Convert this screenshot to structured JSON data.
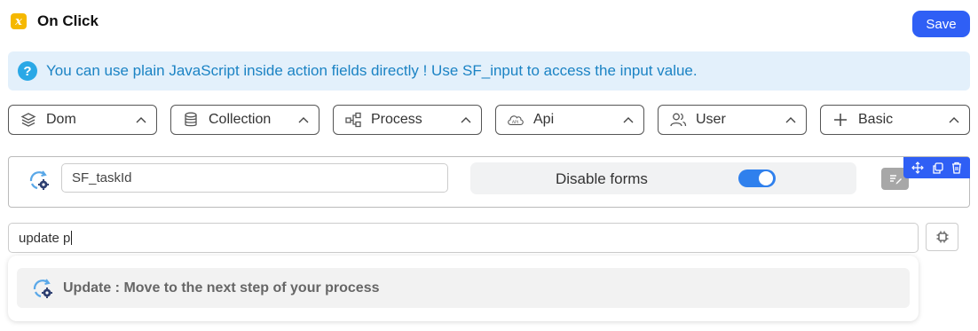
{
  "header": {
    "title": "On Click",
    "save_label": "Save",
    "icon": "function-x-icon",
    "accent": "#f5b800"
  },
  "info": {
    "text": "You can use plain JavaScript inside action fields directly ! Use SF_input to access the input value.",
    "icon": "question-icon",
    "color": "#1b83c4",
    "background": "#e3f0fb"
  },
  "categories": [
    {
      "label": "Dom",
      "icon": "layers-icon"
    },
    {
      "label": "Collection",
      "icon": "database-icon"
    },
    {
      "label": "Process",
      "icon": "process-flow-icon"
    },
    {
      "label": "Api",
      "icon": "api-cloud-icon"
    },
    {
      "label": "User",
      "icon": "users-icon"
    },
    {
      "label": "Basic",
      "icon": "plus-icon"
    }
  ],
  "action": {
    "field_value": "SF_taskId",
    "disable_forms_label": "Disable forms",
    "disable_forms_enabled": true,
    "toolbar_icons": [
      "move-icon",
      "copy-icon",
      "trash-icon"
    ]
  },
  "search": {
    "value": "update p"
  },
  "suggestions": [
    {
      "text": "Update : Move to the next step of your process",
      "icon": "update-sync-icon"
    }
  ],
  "colors": {
    "primary": "#2f5ff5",
    "toggle": "#2f80ed"
  }
}
